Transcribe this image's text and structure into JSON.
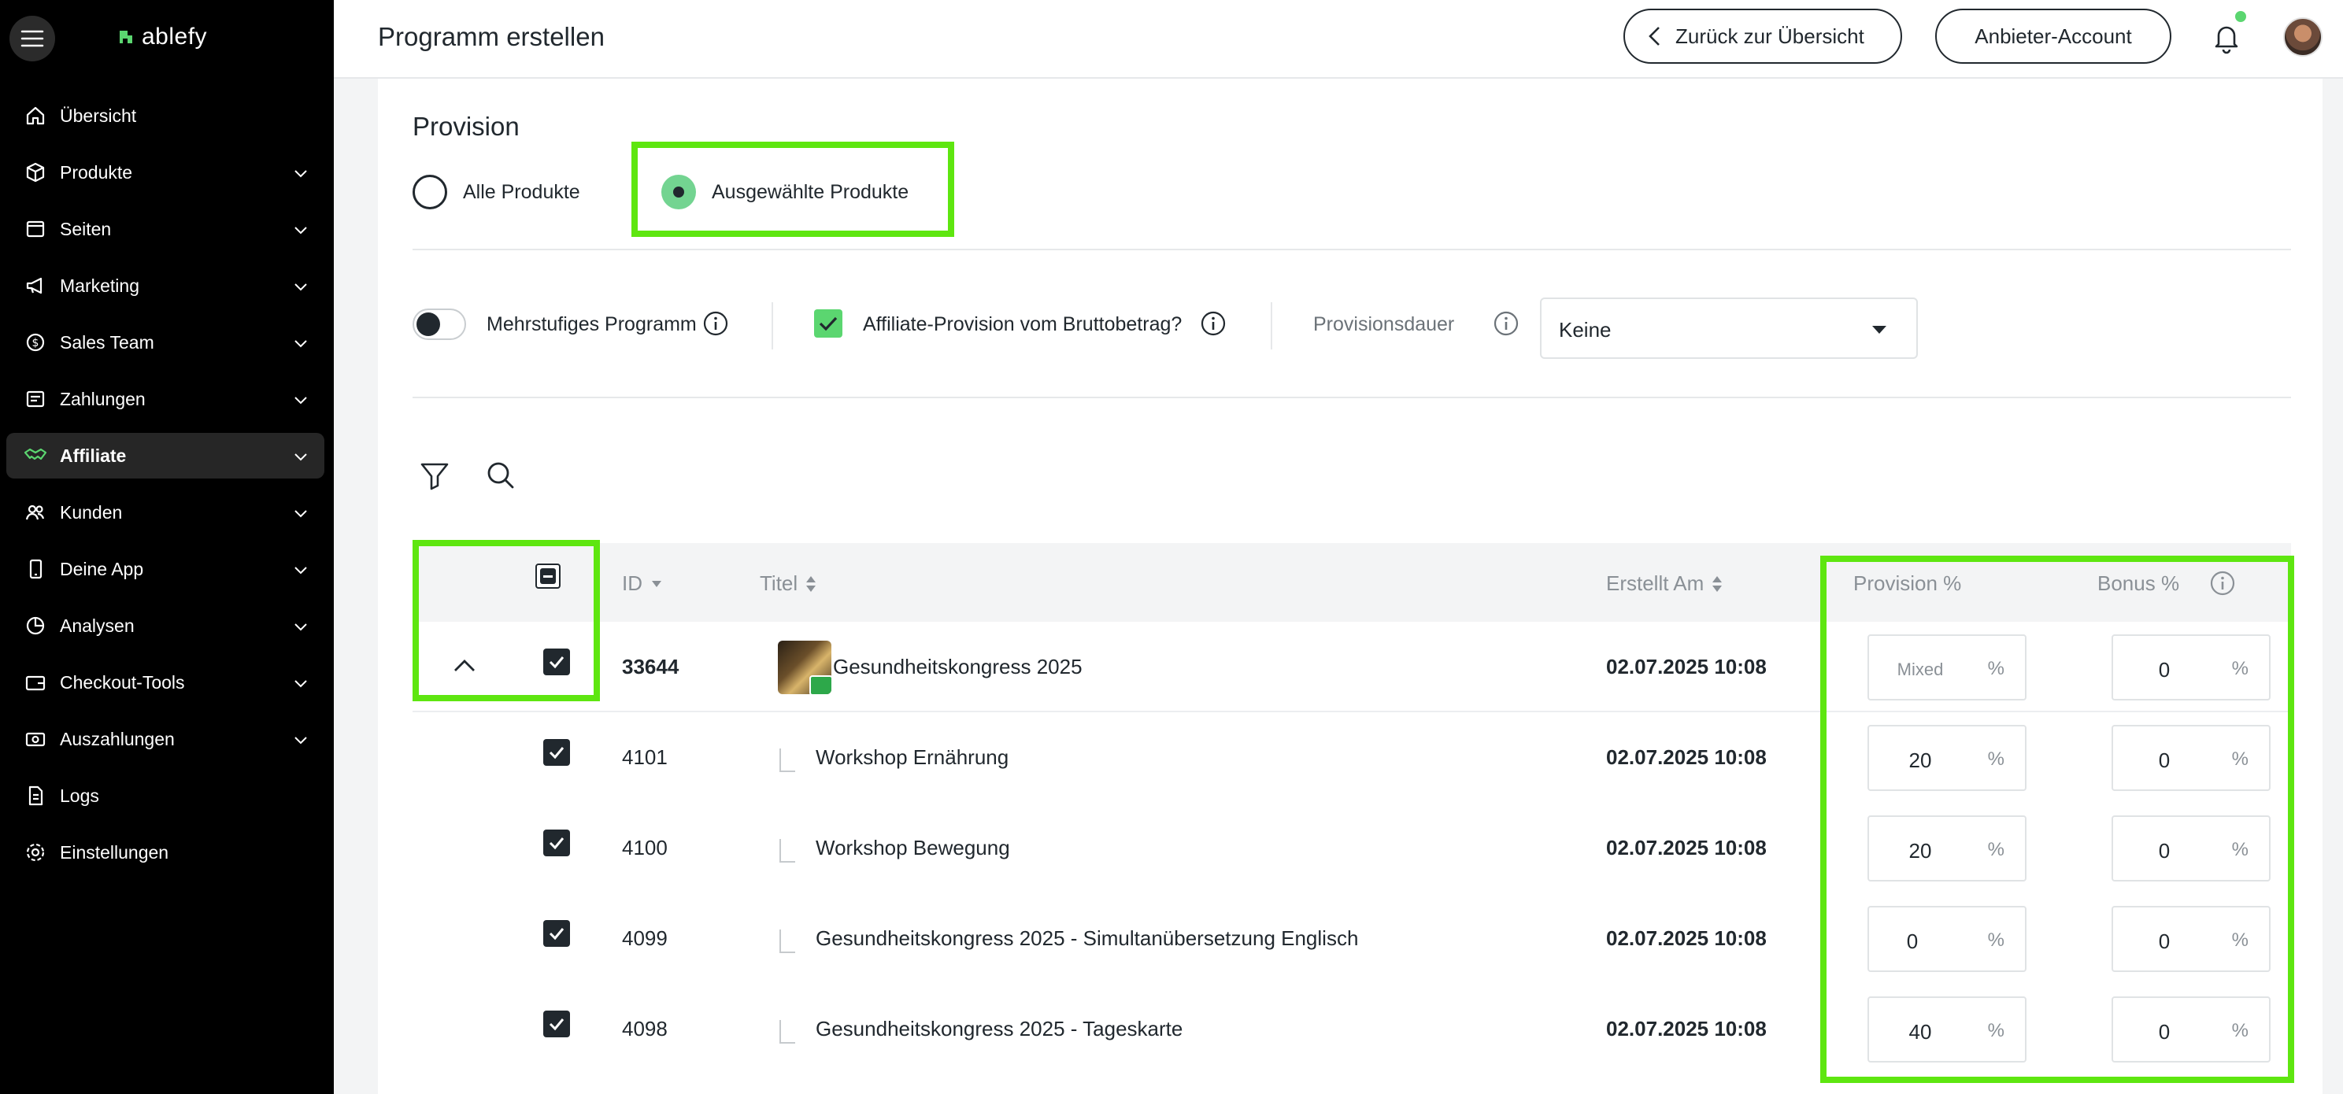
{
  "sidebar": {
    "logo_text": "ablefy",
    "items": [
      {
        "label": "Übersicht",
        "icon": "home-icon",
        "chevron": false,
        "active": false
      },
      {
        "label": "Produkte",
        "icon": "box-icon",
        "chevron": true,
        "active": false
      },
      {
        "label": "Seiten",
        "icon": "page-icon",
        "chevron": true,
        "active": false
      },
      {
        "label": "Marketing",
        "icon": "megaphone-icon",
        "chevron": true,
        "active": false
      },
      {
        "label": "Sales Team",
        "icon": "dollar-circle-icon",
        "chevron": true,
        "active": false
      },
      {
        "label": "Zahlungen",
        "icon": "receipt-icon",
        "chevron": true,
        "active": false
      },
      {
        "label": "Affiliate",
        "icon": "handshake-icon",
        "chevron": true,
        "active": true
      },
      {
        "label": "Kunden",
        "icon": "users-icon",
        "chevron": true,
        "active": false
      },
      {
        "label": "Deine App",
        "icon": "phone-icon",
        "chevron": true,
        "active": false
      },
      {
        "label": "Analysen",
        "icon": "pie-chart-icon",
        "chevron": true,
        "active": false
      },
      {
        "label": "Checkout-Tools",
        "icon": "wallet-icon",
        "chevron": true,
        "active": false
      },
      {
        "label": "Auszahlungen",
        "icon": "cash-icon",
        "chevron": true,
        "active": false
      },
      {
        "label": "Logs",
        "icon": "document-icon",
        "chevron": false,
        "active": false
      },
      {
        "label": "Einstellungen",
        "icon": "gear-icon",
        "chevron": false,
        "active": false
      }
    ]
  },
  "header": {
    "title": "Programm erstellen",
    "back_button": "Zurück zur Übersicht",
    "account_button": "Anbieter-Account"
  },
  "provision": {
    "title": "Provision",
    "option_all": "Alle Produkte",
    "option_selected": "Ausgewählte Produkte",
    "selected_option": "Ausgewählte Produkte"
  },
  "options": {
    "multilevel_label": "Mehrstufiges Programm",
    "multilevel_enabled": false,
    "gross_label": "Affiliate-Provision vom Bruttobetrag?",
    "gross_checked": true,
    "duration_label": "Provisionsdauer",
    "duration_value": "Keine"
  },
  "table": {
    "columns": {
      "id": "ID",
      "title": "Titel",
      "created": "Erstellt Am",
      "provision": "Provision %",
      "bonus": "Bonus %"
    },
    "unit": "%",
    "rows": [
      {
        "id": "33644",
        "title": "Gesundheitskongress 2025",
        "created": "02.07.2025 10:08",
        "provision": "Mixed",
        "bonus": "0",
        "checked": true,
        "parent": true
      },
      {
        "id": "4101",
        "title": "Workshop Ernährung",
        "created": "02.07.2025 10:08",
        "provision": "20",
        "bonus": "0",
        "checked": true,
        "parent": false
      },
      {
        "id": "4100",
        "title": "Workshop Bewegung",
        "created": "02.07.2025 10:08",
        "provision": "20",
        "bonus": "0",
        "checked": true,
        "parent": false
      },
      {
        "id": "4099",
        "title": "Gesundheitskongress 2025 - Simultanübersetzung Englisch",
        "created": "02.07.2025 10:08",
        "provision": "0",
        "bonus": "0",
        "checked": true,
        "parent": false
      },
      {
        "id": "4098",
        "title": "Gesundheitskongress 2025 - Tageskarte",
        "created": "02.07.2025 10:08",
        "provision": "40",
        "bonus": "0",
        "checked": true,
        "parent": false
      }
    ]
  },
  "colors": {
    "highlight": "#5ee610",
    "accent_green": "#5bd670",
    "text": "#21282e",
    "muted": "#8a9096"
  }
}
